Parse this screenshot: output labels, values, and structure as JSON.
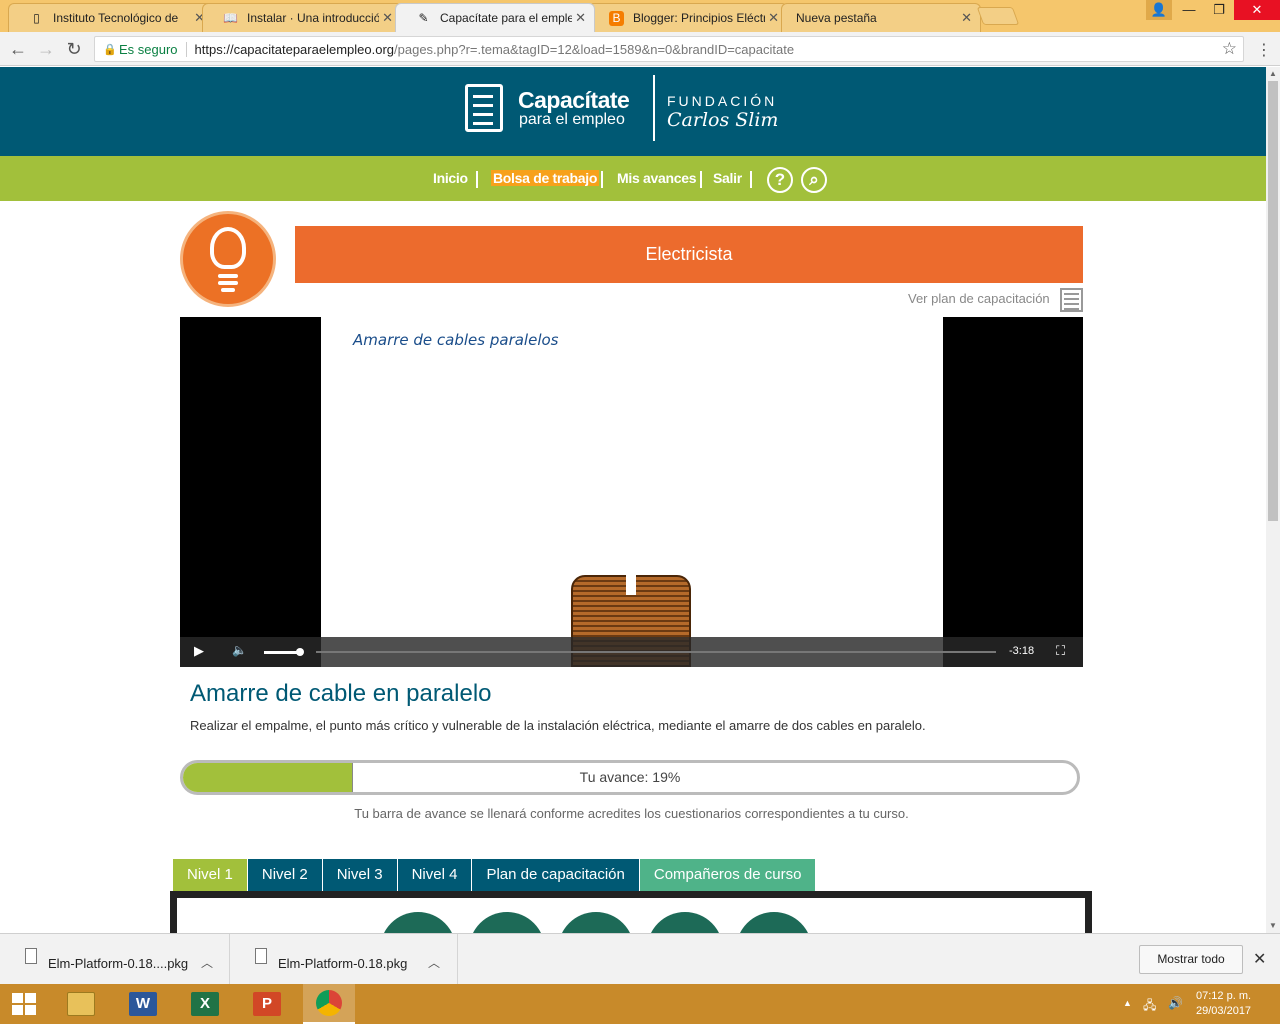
{
  "browser": {
    "tabs": [
      {
        "title": "Instituto Tecnológico de",
        "icon": "doc-icon"
      },
      {
        "title": "Instalar · Una introducció",
        "icon": "book-icon"
      },
      {
        "title": "Capacítate para el emple",
        "icon": "edit-icon"
      },
      {
        "title": "Blogger: Principios Eléctr",
        "icon": "blogger-icon"
      },
      {
        "title": "Nueva pestaña",
        "icon": ""
      }
    ],
    "secure_label": "Es seguro",
    "url_host": "https://capacitateparaelempleo.org",
    "url_rest": "/pages.php?r=.tema&tagID=12&load=1589&n=0&brandID=capacitate"
  },
  "site": {
    "logo_main": "Capacítate",
    "logo_sub": "para el empleo",
    "fundacion": "FUNDACIÓN",
    "fundacion_sub": "Carlos Slim",
    "nav": {
      "inicio": "Inicio",
      "bolsa": "Bolsa de trabajo",
      "avances": "Mis avances",
      "salir": "Salir",
      "help_glyph": "?",
      "search_glyph": "⌕"
    },
    "course_title": "Electricista",
    "plan_link": "Ver plan de capacitación"
  },
  "video": {
    "caption": "Amarre de cables paralelos",
    "time_remaining": "-3:18",
    "play_glyph": "▶",
    "volume_glyph": "🔈",
    "fullscreen_glyph": "⛶",
    "volume_level": 0.8
  },
  "lesson": {
    "title": "Amarre de cable en paralelo",
    "description": "Realizar el empalme, el punto más crítico y vulnerable de la instalación eléctrica, mediante el amarre de dos cables en paralelo."
  },
  "progress": {
    "label": "Tu avance: 19%",
    "percent": 19,
    "note": "Tu barra de avance se llenará conforme acredites los cuestionarios correspondientes a tu curso."
  },
  "level_tabs": [
    "Nivel 1",
    "Nivel 2",
    "Nivel 3",
    "Nivel 4",
    "Plan de capacitación",
    "Compañeros de curso"
  ],
  "downloads": {
    "items": [
      "Elm-Platform-0.18....pkg",
      "Elm-Platform-0.18.pkg"
    ],
    "show_all": "Mostrar todo"
  },
  "taskbar": {
    "time": "07:12 p. m.",
    "date": "29/03/2017"
  },
  "colors": {
    "header": "#005974",
    "nav": "#a2c03b",
    "accent_orange": "#ec6b2d",
    "highlight": "#f7a11a",
    "taskbar": "#c88a2a"
  }
}
